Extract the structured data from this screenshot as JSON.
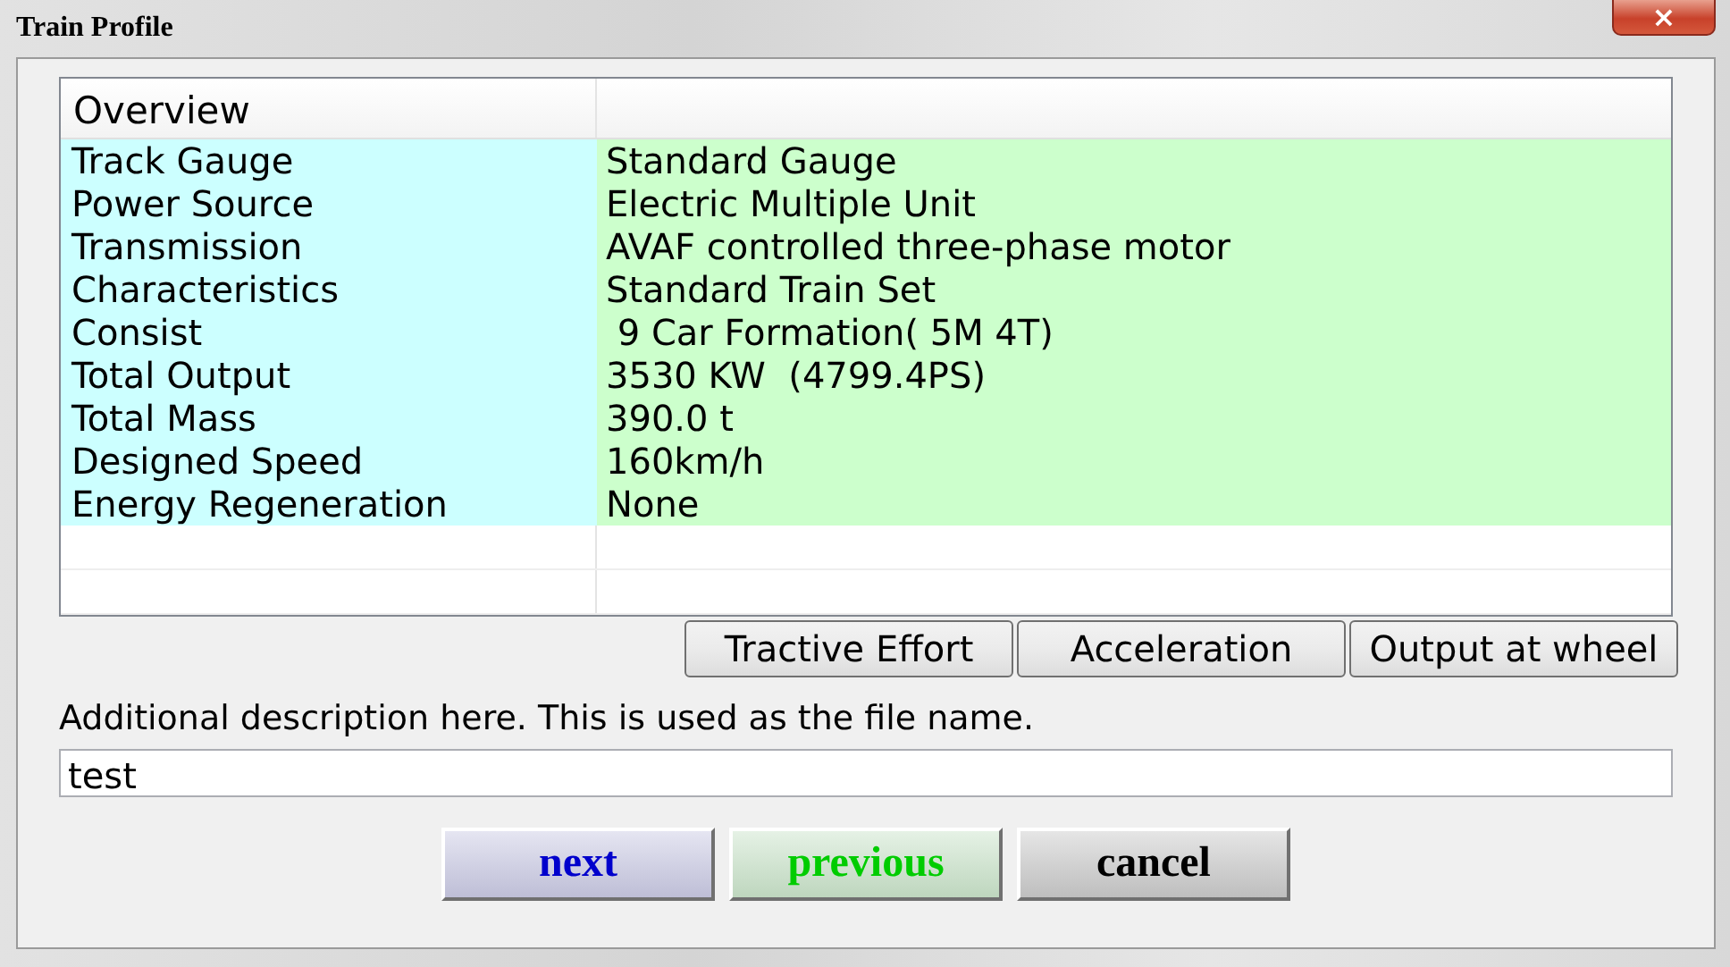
{
  "window": {
    "title": "Train Profile",
    "close": "×"
  },
  "table": {
    "header": "Overview",
    "rows": [
      {
        "label": "Track Gauge",
        "value": "Standard Gauge"
      },
      {
        "label": "Power Source",
        "value": "Electric Multiple Unit"
      },
      {
        "label": "Transmission",
        "value": "AVAF controlled three-phase motor"
      },
      {
        "label": "Characteristics",
        "value": "Standard Train Set"
      },
      {
        "label": "Consist",
        "value": " 9 Car Formation( 5M 4T)"
      },
      {
        "label": "Total Output",
        "value": "3530 KW  (4799.4PS)"
      },
      {
        "label": "Total Mass",
        "value": "390.0 t"
      },
      {
        "label": "Designed Speed",
        "value": "160km/h"
      },
      {
        "label": "Energy Regeneration",
        "value": "None"
      }
    ]
  },
  "chart_buttons": [
    "Tractive Effort",
    "Acceleration",
    "Output at wheel"
  ],
  "description": {
    "label": "Additional description here. This is used as the file name.",
    "value": "test"
  },
  "buttons": [
    {
      "label": "next",
      "color": "#0000cc"
    },
    {
      "label": "previous",
      "color": "#00cc00"
    },
    {
      "label": "cancel",
      "color": "#000000"
    }
  ]
}
